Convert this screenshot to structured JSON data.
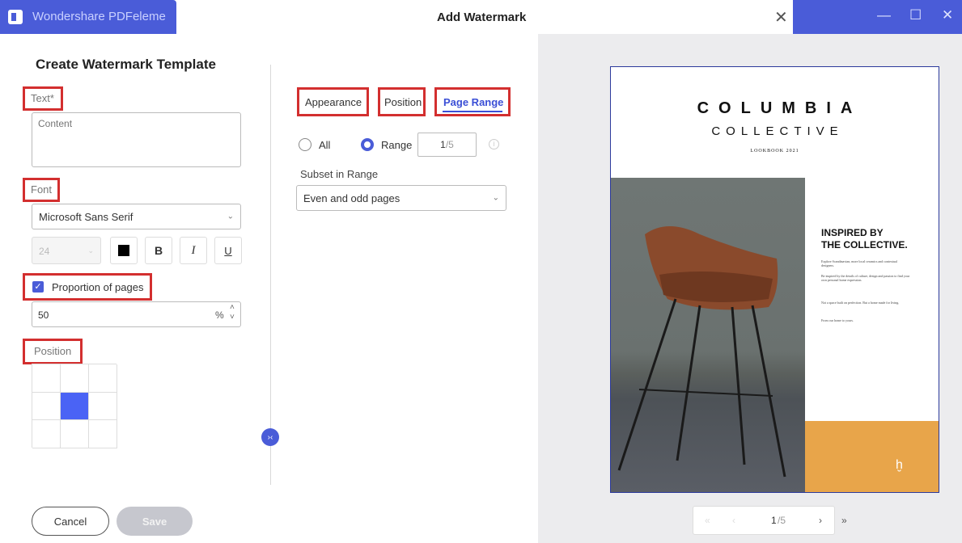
{
  "titlebar": {
    "app_name": "Wondershare PDFeleme",
    "dialog_title": "Add Watermark",
    "close_glyph": "✕",
    "minimize_glyph": "—",
    "maximize_glyph": "☐",
    "window_close_glyph": "✕"
  },
  "left": {
    "title": "Create Watermark Template",
    "text_label": "Text*",
    "text_placeholder": "Content",
    "font_label": "Font",
    "font_value": "Microsoft Sans Serif",
    "font_size": "24",
    "bold_label": "B",
    "italic_label": "I",
    "underline_label": "U",
    "proportion_label": "Proportion of pages",
    "proportion_checked": true,
    "proportion_value": "50",
    "percent_sign": "%",
    "position_label": "Position",
    "position_selected_cell": 4,
    "cancel_label": "Cancel",
    "save_label": "Save"
  },
  "middle": {
    "tabs": [
      {
        "label": "Appearance",
        "active": false
      },
      {
        "label": "Position",
        "active": false
      },
      {
        "label": "Page Range",
        "active": true
      }
    ],
    "range_options": {
      "all_label": "All",
      "range_label": "Range",
      "selected": "Range"
    },
    "page_current": "1",
    "page_total": "/5",
    "subset_label": "Subset in Range",
    "subset_value": "Even and odd pages"
  },
  "preview": {
    "brand_line1": "COLUMBIA",
    "brand_line2": "COLLECTIVE",
    "brand_line3": "LOOKBOOK 2021",
    "headline_1": "INSPIRED BY",
    "headline_2": "THE COLLECTIVE.",
    "body_1": "Explore Scandinavian, more local ceramics and contextual designers.",
    "body_2": "Be inspired by the details of culture, design and passion to find your own personal home expression.",
    "body_3": "Not a space built on perfection. But a home made for living.",
    "body_4": "From our home to yours.",
    "pager_current": "1",
    "pager_total": "/5",
    "colors": {
      "accent": "#e8a54a",
      "brand_blue": "#4a5cd8"
    }
  }
}
